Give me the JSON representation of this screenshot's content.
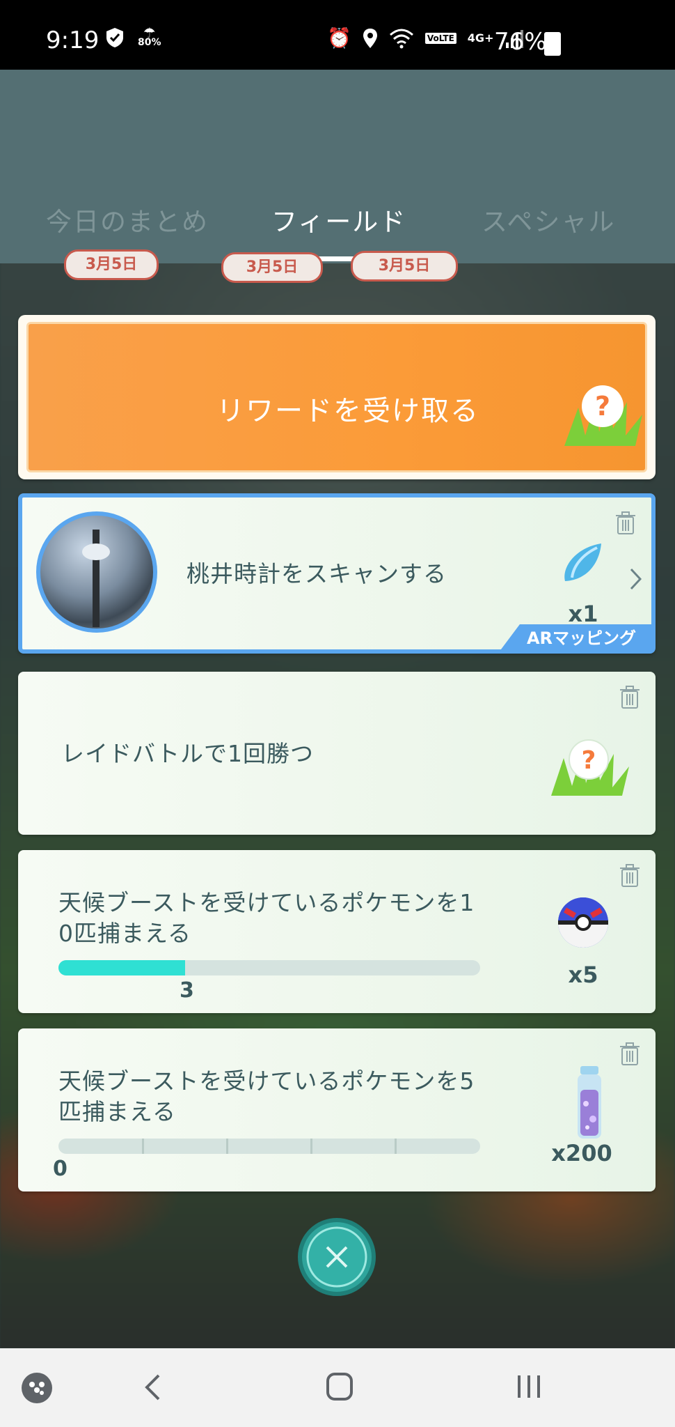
{
  "status": {
    "time": "9:19",
    "weather_percent": "80%",
    "network": "4G+",
    "volte": "VoLTE",
    "battery": "76%"
  },
  "tabs": [
    {
      "label": "今日のまとめ",
      "active": false
    },
    {
      "label": "フィールド",
      "active": true
    },
    {
      "label": "スペシャル",
      "active": false
    }
  ],
  "stamps": [
    "3月5日",
    "3月5日",
    "3月5日"
  ],
  "reward_banner": {
    "label": "リワードを受け取る",
    "icon": "mystery-reward-grass-icon"
  },
  "tasks": [
    {
      "title": "桃井時計をスキャンする",
      "reward_icon": "stardust-shard-icon",
      "reward_count": "x1",
      "badge": "ARマッピング"
    },
    {
      "title": "レイドバトルで1回勝つ",
      "reward_icon": "mystery-reward-grass-icon"
    },
    {
      "title_line1": "天候ブーストを受けているポケモンを1",
      "title_line2": "0匹捕まえる",
      "progress_value": "3",
      "progress_fraction": 0.3,
      "reward_icon": "great-ball-icon",
      "reward_count": "x5"
    },
    {
      "title_line1": "天候ブーストを受けているポケモンを5",
      "title_line2": "匹捕まえる",
      "progress_value": "0",
      "progress_fraction": 0,
      "reward_icon": "stardust-vial-icon",
      "reward_count": "x200"
    }
  ],
  "colors": {
    "header": "#546f73",
    "reward_orange": "#fb9b38",
    "progress_fill": "#2fe0d3",
    "text": "#3b5a5e",
    "highlight_border": "#5aa6ef"
  }
}
